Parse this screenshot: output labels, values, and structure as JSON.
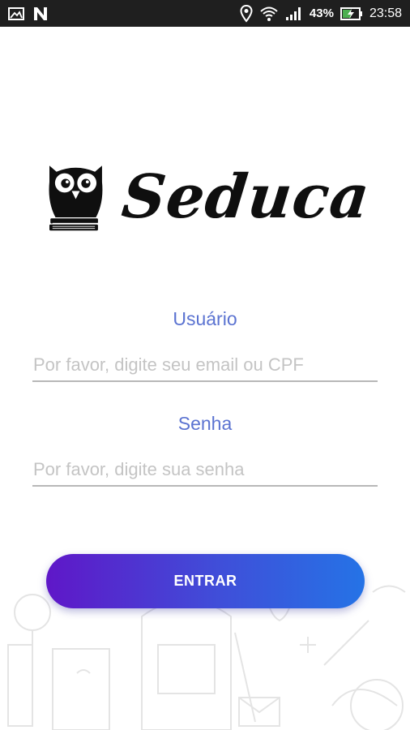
{
  "status_bar": {
    "battery_percent": "43%",
    "time": "23:58",
    "icons": [
      "image-icon",
      "n-icon",
      "location-icon",
      "wifi-icon",
      "signal-icon",
      "battery-charging-icon"
    ]
  },
  "logo": {
    "wordmark": "Seduca",
    "icon": "owl-on-books-icon"
  },
  "form": {
    "user_label": "Usuário",
    "user_placeholder": "Por favor, digite seu email ou CPF",
    "password_label": "Senha",
    "password_placeholder": "Por favor, digite sua senha",
    "submit_label": "ENTRAR"
  },
  "colors": {
    "label_blue": "#5b73d1",
    "button_gradient_start": "#5f17c8",
    "button_gradient_end": "#2573e6"
  }
}
